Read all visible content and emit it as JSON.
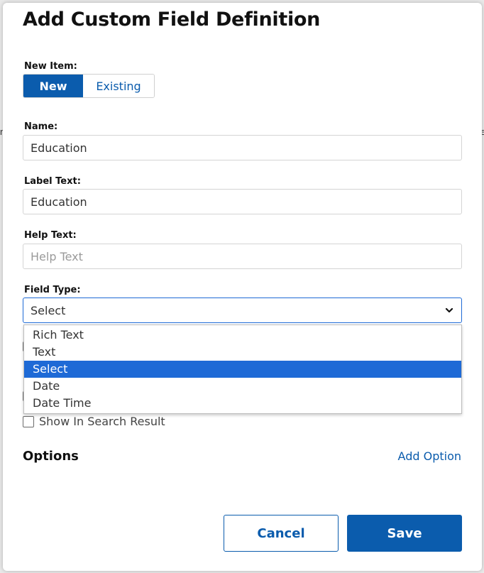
{
  "dialog": {
    "title": "Add Custom Field Definition",
    "new_item": {
      "label": "New Item:",
      "options": [
        "New",
        "Existing"
      ],
      "selected": "New"
    },
    "name": {
      "label": "Name:",
      "value": "Education"
    },
    "label_text": {
      "label": "Label Text:",
      "value": "Education"
    },
    "help_text": {
      "label": "Help Text:",
      "value": "",
      "placeholder": "Help Text"
    },
    "field_type": {
      "label": "Field Type:",
      "value": "Select",
      "options": [
        "Rich Text",
        "Text",
        "Select",
        "Date",
        "Date Time"
      ],
      "highlighted": "Select"
    },
    "show_in_search": {
      "label": "Show In Search Result",
      "checked": false
    },
    "options_section": {
      "title": "Options",
      "add_label": "Add Option"
    },
    "buttons": {
      "cancel": "Cancel",
      "save": "Save"
    }
  },
  "colors": {
    "primary": "#0b5cad",
    "highlight": "#1e6ad6"
  }
}
